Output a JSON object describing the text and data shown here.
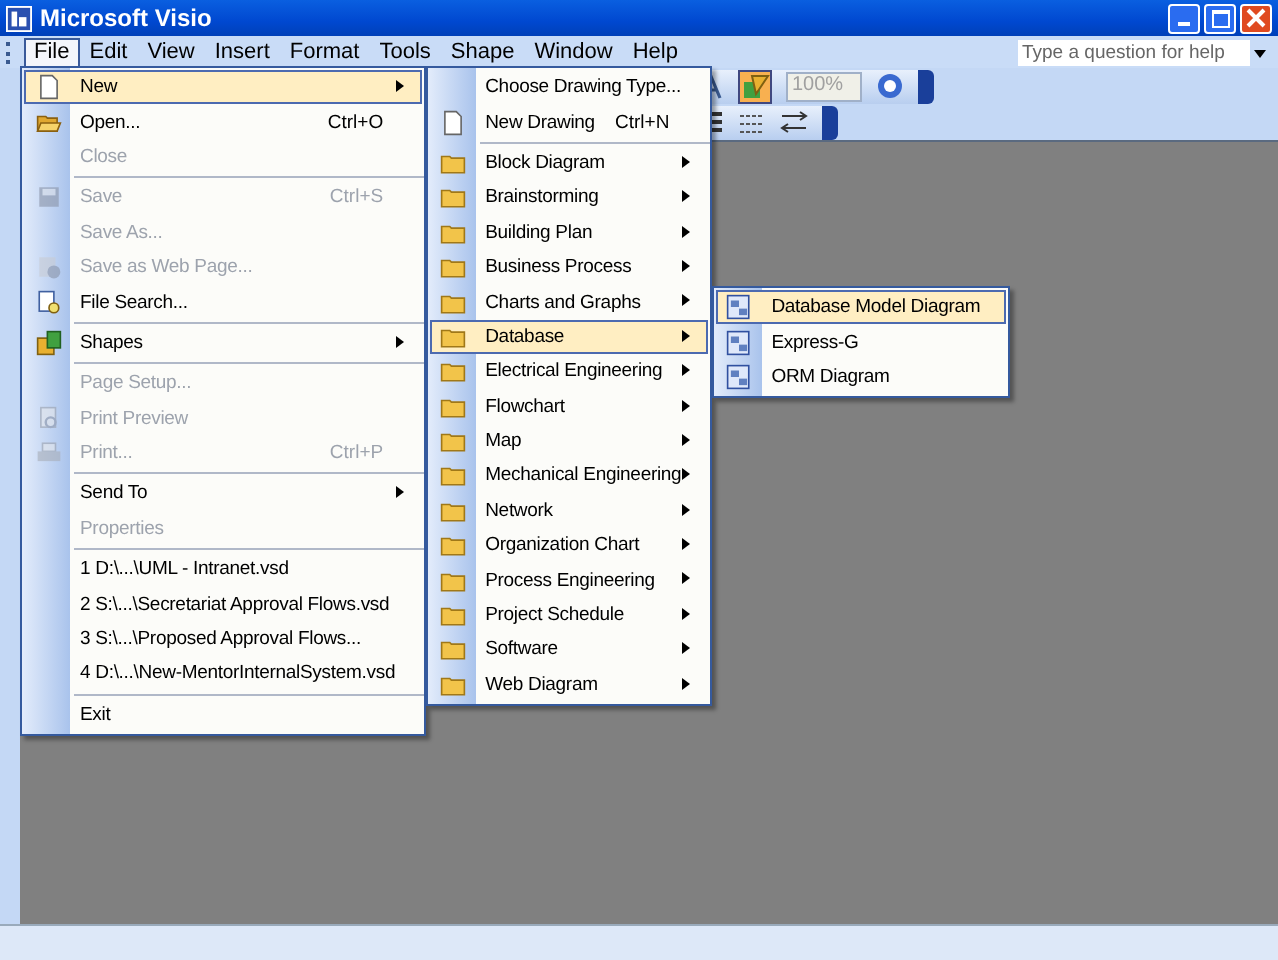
{
  "window": {
    "title": "Microsoft Visio"
  },
  "menu_bar": [
    {
      "label": "File",
      "selected": true
    },
    {
      "label": "Edit",
      "selected": false
    },
    {
      "label": "View",
      "selected": false
    },
    {
      "label": "Insert",
      "selected": false
    },
    {
      "label": "Format",
      "selected": false
    },
    {
      "label": "Tools",
      "selected": false
    },
    {
      "label": "Shape",
      "selected": false
    },
    {
      "label": "Window",
      "selected": false
    },
    {
      "label": "Help",
      "selected": false
    }
  ],
  "help_box": {
    "placeholder": "Type a question for help"
  },
  "toolbar": {
    "zoom": "100%",
    "zoom_disabled": true,
    "shapes_button_on": true
  },
  "file_menu": [
    {
      "kind": "page",
      "label": "New",
      "disabled": false,
      "submenu": true,
      "selected": true
    },
    {
      "kind": "folder-open",
      "label": "Open...",
      "shortcut": "Ctrl+O",
      "disabled": false,
      "submenu": false,
      "selected": false
    },
    {
      "kind": "plain",
      "label": "Close",
      "disabled": true,
      "submenu": false,
      "selected": false
    },
    {
      "kind": "separator"
    },
    {
      "kind": "disk",
      "label": "Save",
      "shortcut": "Ctrl+S",
      "disabled": true,
      "submenu": false,
      "selected": false
    },
    {
      "kind": "plain",
      "label": "Save As...",
      "disabled": true,
      "submenu": false,
      "selected": false
    },
    {
      "kind": "globe",
      "label": "Save as Web Page...",
      "disabled": true,
      "submenu": false,
      "selected": false
    },
    {
      "kind": "search",
      "label": "File Search...",
      "disabled": false,
      "submenu": false,
      "selected": false
    },
    {
      "kind": "separator"
    },
    {
      "kind": "shapes",
      "label": "Shapes",
      "disabled": false,
      "submenu": true,
      "selected": false
    },
    {
      "kind": "separator"
    },
    {
      "kind": "plain",
      "label": "Page Setup...",
      "disabled": true,
      "submenu": false,
      "selected": false
    },
    {
      "kind": "preview",
      "label": "Print Preview",
      "disabled": true,
      "submenu": false,
      "selected": false
    },
    {
      "kind": "printer",
      "label": "Print...",
      "shortcut": "Ctrl+P",
      "disabled": true,
      "submenu": false,
      "selected": false
    },
    {
      "kind": "separator"
    },
    {
      "kind": "plain",
      "label": "Send To",
      "disabled": false,
      "submenu": true,
      "selected": false
    },
    {
      "kind": "plain",
      "label": "Properties",
      "disabled": true,
      "submenu": false,
      "selected": false
    },
    {
      "kind": "separator"
    },
    {
      "kind": "plain",
      "label": "1 D:\\...\\UML - Intranet.vsd",
      "disabled": false,
      "submenu": false,
      "selected": false
    },
    {
      "kind": "plain",
      "label": "2 S:\\...\\Secretariat Approval Flows.vsd",
      "disabled": false,
      "submenu": false,
      "selected": false
    },
    {
      "kind": "plain",
      "label": "3 S:\\...\\Proposed Approval Flows...",
      "disabled": false,
      "submenu": false,
      "selected": false
    },
    {
      "kind": "plain",
      "label": "4 D:\\...\\New-MentorInternalSystem.vsd",
      "disabled": false,
      "submenu": false,
      "selected": false
    },
    {
      "kind": "separator"
    },
    {
      "kind": "plain",
      "label": "Exit",
      "disabled": false,
      "submenu": false,
      "selected": false
    }
  ],
  "new_submenu": [
    {
      "kind": "plain",
      "label": "Choose Drawing Type...",
      "disabled": false,
      "submenu": false,
      "selected": false
    },
    {
      "kind": "page",
      "label": "New Drawing",
      "shortcut": "Ctrl+N",
      "disabled": false,
      "submenu": false,
      "selected": false
    },
    {
      "kind": "separator"
    },
    {
      "kind": "folder",
      "label": "Block Diagram",
      "disabled": false,
      "submenu": true,
      "selected": false
    },
    {
      "kind": "folder",
      "label": "Brainstorming",
      "disabled": false,
      "submenu": true,
      "selected": false
    },
    {
      "kind": "folder",
      "label": "Building Plan",
      "disabled": false,
      "submenu": true,
      "selected": false
    },
    {
      "kind": "folder",
      "label": "Business Process",
      "disabled": false,
      "submenu": true,
      "selected": false
    },
    {
      "kind": "folder",
      "label": "Charts and Graphs",
      "disabled": false,
      "submenu": true,
      "selected": false
    },
    {
      "kind": "folder",
      "label": "Database",
      "disabled": false,
      "submenu": true,
      "selected": true
    },
    {
      "kind": "folder",
      "label": "Electrical Engineering",
      "disabled": false,
      "submenu": true,
      "selected": false
    },
    {
      "kind": "folder",
      "label": "Flowchart",
      "disabled": false,
      "submenu": true,
      "selected": false
    },
    {
      "kind": "folder",
      "label": "Map",
      "disabled": false,
      "submenu": true,
      "selected": false
    },
    {
      "kind": "folder",
      "label": "Mechanical Engineering",
      "disabled": false,
      "submenu": true,
      "selected": false
    },
    {
      "kind": "folder",
      "label": "Network",
      "disabled": false,
      "submenu": true,
      "selected": false
    },
    {
      "kind": "folder",
      "label": "Organization Chart",
      "disabled": false,
      "submenu": true,
      "selected": false
    },
    {
      "kind": "folder",
      "label": "Process Engineering",
      "disabled": false,
      "submenu": true,
      "selected": false
    },
    {
      "kind": "folder",
      "label": "Project Schedule",
      "disabled": false,
      "submenu": true,
      "selected": false
    },
    {
      "kind": "folder",
      "label": "Software",
      "disabled": false,
      "submenu": true,
      "selected": false
    },
    {
      "kind": "folder",
      "label": "Web Diagram",
      "disabled": false,
      "submenu": true,
      "selected": false
    }
  ],
  "database_submenu": [
    {
      "kind": "stencil",
      "label": "Database Model Diagram",
      "disabled": false,
      "submenu": false,
      "selected": true
    },
    {
      "kind": "stencil",
      "label": "Express-G",
      "disabled": false,
      "submenu": false,
      "selected": false
    },
    {
      "kind": "stencil",
      "label": "ORM Diagram",
      "disabled": false,
      "submenu": false,
      "selected": false
    }
  ]
}
